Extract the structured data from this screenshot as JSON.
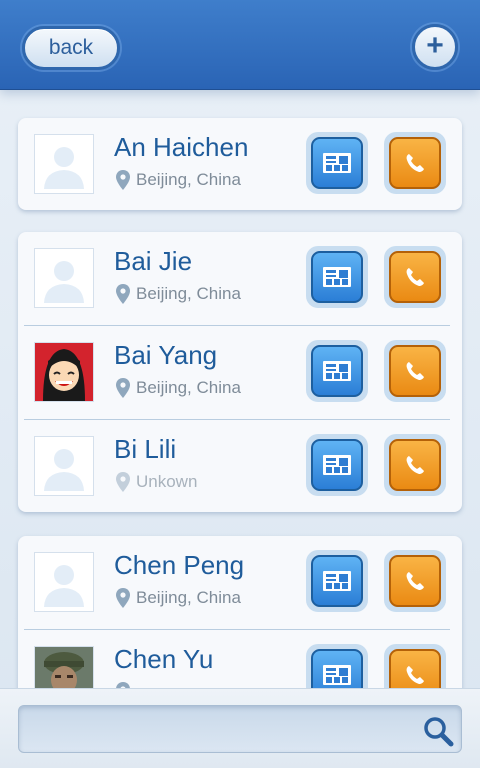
{
  "header": {
    "back_label": "back",
    "add_label": "+"
  },
  "contacts": [
    {
      "name": "An Haichen",
      "location": "Beijing, China",
      "avatar": "placeholder-avatar"
    },
    {
      "name": "Bai Jie",
      "location": "Beijing, China",
      "avatar": "placeholder-avatar"
    },
    {
      "name": "Bai Yang",
      "location": "Beijing, China",
      "avatar": "cartoon-girl-avatar"
    },
    {
      "name": "Bi Lili",
      "location": "Unkown",
      "avatar": "placeholder-avatar"
    },
    {
      "name": "Chen Peng",
      "location": "Beijing, China",
      "avatar": "placeholder-avatar"
    },
    {
      "name": "Chen Yu",
      "location": "",
      "avatar": "soldier-photo-avatar"
    }
  ],
  "search": {
    "placeholder": "",
    "value": ""
  },
  "colors": {
    "header": "#2f6db9",
    "name_text": "#1f5c9b",
    "card_button": "#3a8fe0",
    "call_button": "#f0951f"
  }
}
